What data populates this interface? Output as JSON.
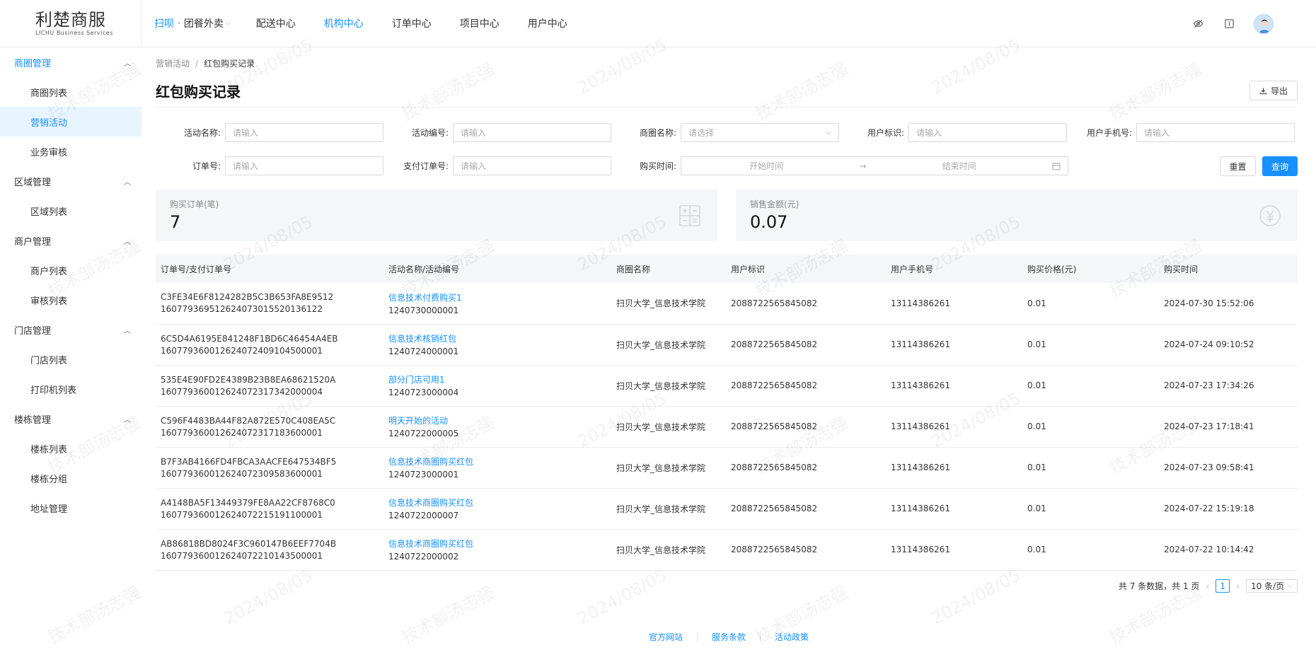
{
  "logo": {
    "cn": "利楚商服",
    "en": "LICHU Business Services"
  },
  "topnav": {
    "brand_primary": "扫呗",
    "brand_secondary": "团餐外卖",
    "items": [
      "配送中心",
      "机构中心",
      "订单中心",
      "项目中心",
      "用户中心"
    ]
  },
  "sidebar": {
    "groups": [
      {
        "label": "商圈管理",
        "items": [
          "商圈列表",
          "营销活动",
          "业务审核"
        ]
      },
      {
        "label": "区域管理",
        "items": [
          "区域列表"
        ]
      },
      {
        "label": "商户管理",
        "items": [
          "商户列表",
          "审核列表"
        ]
      },
      {
        "label": "门店管理",
        "items": [
          "门店列表",
          "打印机列表"
        ]
      },
      {
        "label": "楼栋管理",
        "items": [
          "楼栋列表",
          "楼栋分组",
          "地址管理"
        ]
      }
    ]
  },
  "breadcrumb": {
    "parent": "营销活动",
    "sep": "/",
    "current": "红包购买记录"
  },
  "page": {
    "title": "红包购买记录",
    "export_label": "导出"
  },
  "filters": {
    "activity_name": {
      "label": "活动名称:",
      "placeholder": "请输入"
    },
    "activity_no": {
      "label": "活动编号:",
      "placeholder": "请输入"
    },
    "district_name": {
      "label": "商圈名称:",
      "placeholder": "请选择"
    },
    "user_id": {
      "label": "用户标识:",
      "placeholder": "请输入"
    },
    "user_phone": {
      "label": "用户手机号:",
      "placeholder": "请输入"
    },
    "order_no": {
      "label": "订单号:",
      "placeholder": "请输入"
    },
    "pay_order_no": {
      "label": "支付订单号:",
      "placeholder": "请输入"
    },
    "buy_time": {
      "label": "购买时间:",
      "start": "开始时间",
      "arrow": "→",
      "end": "结束时间"
    },
    "reset_label": "重置",
    "query_label": "查询"
  },
  "stats": {
    "orders": {
      "label": "购买订单(笔)",
      "value": "7"
    },
    "amount": {
      "label": "销售金额(元)",
      "value": "0.07"
    }
  },
  "table": {
    "headers": [
      "订单号/支付订单号",
      "活动名称/活动编号",
      "商圈名称",
      "用户标识",
      "用户手机号",
      "购买价格(元)",
      "购买时间"
    ],
    "rows": [
      {
        "order_no": "C3FE34E6F8124282B5C3B653FA8E9512",
        "pay_no": "160779369512624073015520136122",
        "activity_name": "信息技术付费购买1",
        "activity_no": "1240730000001",
        "district": "扫贝大学_信息技术学院",
        "user_id": "2088722565845082",
        "phone": "13114386261",
        "price": "0.01",
        "time": "2024-07-30 15:52:06"
      },
      {
        "order_no": "6C5D4A6195E841248F1BD6C46454A4EB",
        "pay_no": "160779360012624072409104500001",
        "activity_name": "信息技术核销红包",
        "activity_no": "1240724000001",
        "district": "扫贝大学_信息技术学院",
        "user_id": "2088722565845082",
        "phone": "13114386261",
        "price": "0.01",
        "time": "2024-07-24 09:10:52"
      },
      {
        "order_no": "535E4E90FD2E4389B23B8EA68621520A",
        "pay_no": "160779360012624072317342000004",
        "activity_name": "部分门店可用1",
        "activity_no": "1240723000004",
        "district": "扫贝大学_信息技术学院",
        "user_id": "2088722565845082",
        "phone": "13114386261",
        "price": "0.01",
        "time": "2024-07-23 17:34:26"
      },
      {
        "order_no": "C596F4483BA44F82A872E570C408EA5C",
        "pay_no": "160779360012624072317183600001",
        "activity_name": "明天开始的活动",
        "activity_no": "1240722000005",
        "district": "扫贝大学_信息技术学院",
        "user_id": "2088722565845082",
        "phone": "13114386261",
        "price": "0.01",
        "time": "2024-07-23 17:18:41"
      },
      {
        "order_no": "B7F3AB4166FD4FBCA3AACFE647534BF5",
        "pay_no": "160779360012624072309583600001",
        "activity_name": "信息技术商圈购买红包",
        "activity_no": "1240723000001",
        "district": "扫贝大学_信息技术学院",
        "user_id": "2088722565845082",
        "phone": "13114386261",
        "price": "0.01",
        "time": "2024-07-23 09:58:41"
      },
      {
        "order_no": "A4148BA5F13449379FE8AA22CF8768C0",
        "pay_no": "160779360012624072215191100001",
        "activity_name": "信息技术商圈购买红包",
        "activity_no": "1240722000007",
        "district": "扫贝大学_信息技术学院",
        "user_id": "2088722565845082",
        "phone": "13114386261",
        "price": "0.01",
        "time": "2024-07-22 15:19:18"
      },
      {
        "order_no": "AB86818BD8024F3C960147B6EEF7704B",
        "pay_no": "160779360012624072210143500001",
        "activity_name": "信息技术商圈购买红包",
        "activity_no": "1240722000002",
        "district": "扫贝大学_信息技术学院",
        "user_id": "2088722565845082",
        "phone": "13114386261",
        "price": "0.01",
        "time": "2024-07-22 10:14:42"
      }
    ]
  },
  "pagination": {
    "summary": "共 7 条数据，共 1 页",
    "current": "1",
    "page_size": "10 条/页"
  },
  "footer": {
    "links": [
      "官方网站",
      "服务条款",
      "活动政策"
    ]
  },
  "watermark": {
    "texts": [
      "技术部汤志强",
      "2024/08/05"
    ]
  },
  "colors": {
    "accent": "#1890ff",
    "sidebar_active_bg": "#e8f4ff"
  }
}
